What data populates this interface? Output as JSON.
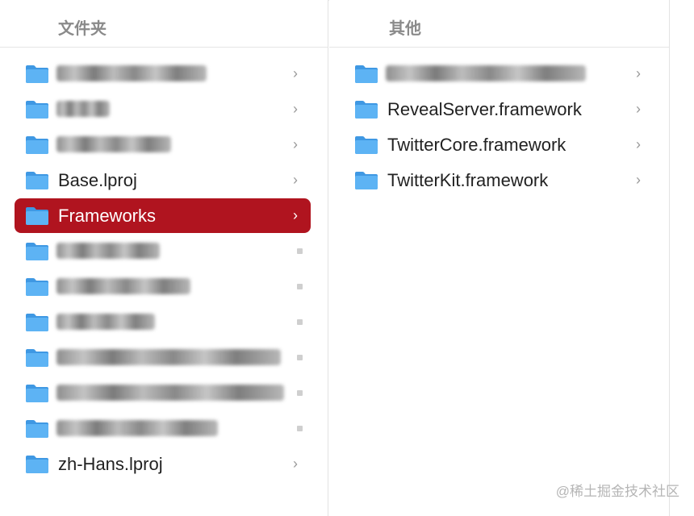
{
  "columns": [
    {
      "header": "文件夹",
      "items": [
        {
          "label": "",
          "blurred": true,
          "blur_width": 186,
          "indicator": "chevron"
        },
        {
          "label": "",
          "blurred": true,
          "blur_width": 66,
          "indicator": "chevron"
        },
        {
          "label": "",
          "blurred": true,
          "blur_width": 142,
          "indicator": "chevron"
        },
        {
          "label": "Base.lproj",
          "blurred": false,
          "indicator": "chevron"
        },
        {
          "label": "Frameworks",
          "blurred": false,
          "selected": true,
          "indicator": "chevron"
        },
        {
          "label": "",
          "blurred": true,
          "blur_width": 128,
          "indicator": "dot"
        },
        {
          "label": "",
          "blurred": true,
          "blur_width": 166,
          "indicator": "dot"
        },
        {
          "label": "",
          "blurred": true,
          "blur_width": 122,
          "indicator": "dot"
        },
        {
          "label": "",
          "blurred": true,
          "blur_width": 278,
          "indicator": "dot"
        },
        {
          "label": "",
          "blurred": true,
          "blur_width": 282,
          "indicator": "dot"
        },
        {
          "label": "",
          "blurred": true,
          "blur_width": 200,
          "indicator": "dot"
        },
        {
          "label": "zh-Hans.lproj",
          "blurred": false,
          "indicator": "chevron"
        }
      ]
    },
    {
      "header": "其他",
      "items": [
        {
          "label": "",
          "blurred": true,
          "blur_width": 248,
          "indicator": "chevron"
        },
        {
          "label": "RevealServer.framework",
          "blurred": false,
          "indicator": "chevron"
        },
        {
          "label": "TwitterCore.framework",
          "blurred": false,
          "indicator": "chevron"
        },
        {
          "label": "TwitterKit.framework",
          "blurred": false,
          "indicator": "chevron"
        }
      ]
    }
  ],
  "icons": {
    "folder": "folder-icon",
    "chevron": "chevron-right-icon"
  },
  "colors": {
    "selection": "#b0141f",
    "folder_back": "#3f98e3",
    "folder_front": "#5db3f4",
    "chevron": "#9a9a9a",
    "text": "#222222"
  },
  "watermark": "@稀土掘金技术社区"
}
